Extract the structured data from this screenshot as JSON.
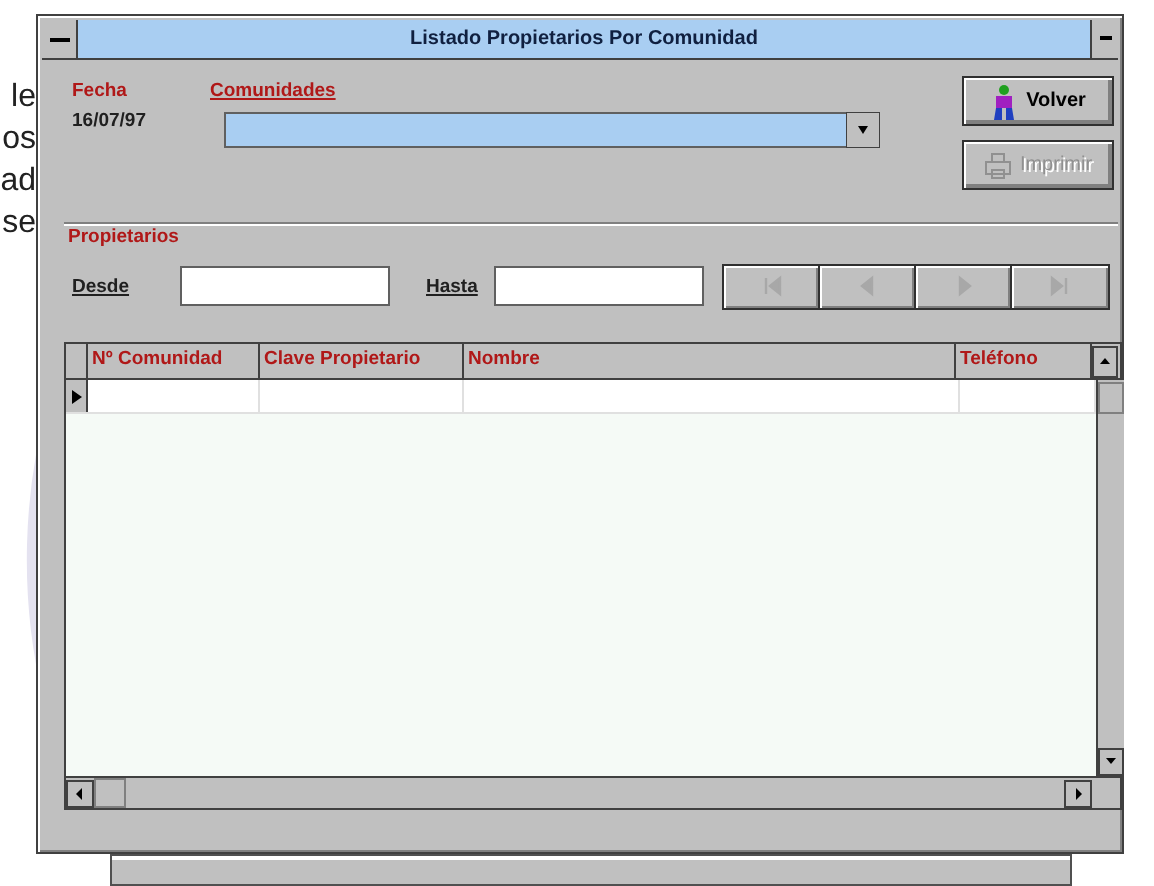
{
  "background_text": [
    "le",
    "os",
    "ad",
    "se"
  ],
  "window": {
    "title": "Listado Propietarios Por Comunidad"
  },
  "fecha": {
    "label": "Fecha",
    "value": "16/07/97"
  },
  "comunidades": {
    "label": "Comunidades"
  },
  "buttons": [
    {
      "label": "Volver",
      "kind": "exit",
      "disabled": false
    },
    {
      "label": "Imprimir",
      "kind": "print",
      "disabled": true
    }
  ],
  "propietarios": {
    "label": "Propietarios",
    "desde": "Desde",
    "hasta": "Hasta"
  },
  "nav_buttons": [
    {
      "kind": "first",
      "disabled": true
    },
    {
      "kind": "prev",
      "disabled": true
    },
    {
      "kind": "next",
      "disabled": true
    },
    {
      "kind": "last",
      "disabled": true
    }
  ],
  "table": {
    "columns": [
      "Nº Comunidad",
      "Clave Propietario",
      "Nombre",
      "Teléfono"
    ]
  }
}
